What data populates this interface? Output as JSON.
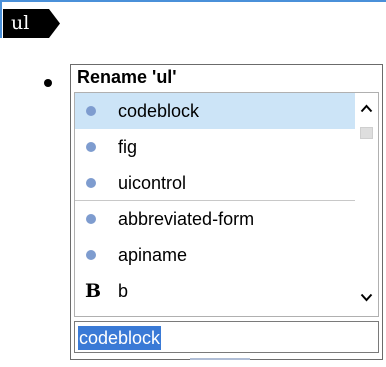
{
  "tag_marker": {
    "label": "ul",
    "icon": "tag-marker-icon"
  },
  "popup": {
    "title": "Rename 'ul'",
    "items": [
      {
        "label": "codeblock",
        "icon": "element-dot-icon",
        "selected": true
      },
      {
        "label": "fig",
        "icon": "element-dot-icon"
      },
      {
        "label": "uicontrol",
        "icon": "element-dot-icon"
      },
      {
        "label": "abbreviated-form",
        "icon": "element-dot-icon"
      },
      {
        "label": "apiname",
        "icon": "element-dot-icon"
      },
      {
        "label": "b",
        "icon": "bold-icon",
        "icon_glyph": "B"
      }
    ],
    "scroll_up_glyph": "⌃",
    "scroll_down_glyph": "⌄",
    "input_value": "codeblock"
  },
  "colors": {
    "selection": "#cce4f7",
    "accent": "#4a90d9",
    "dot": "#7e9ccf",
    "input_highlight": "#3a7ad6"
  }
}
